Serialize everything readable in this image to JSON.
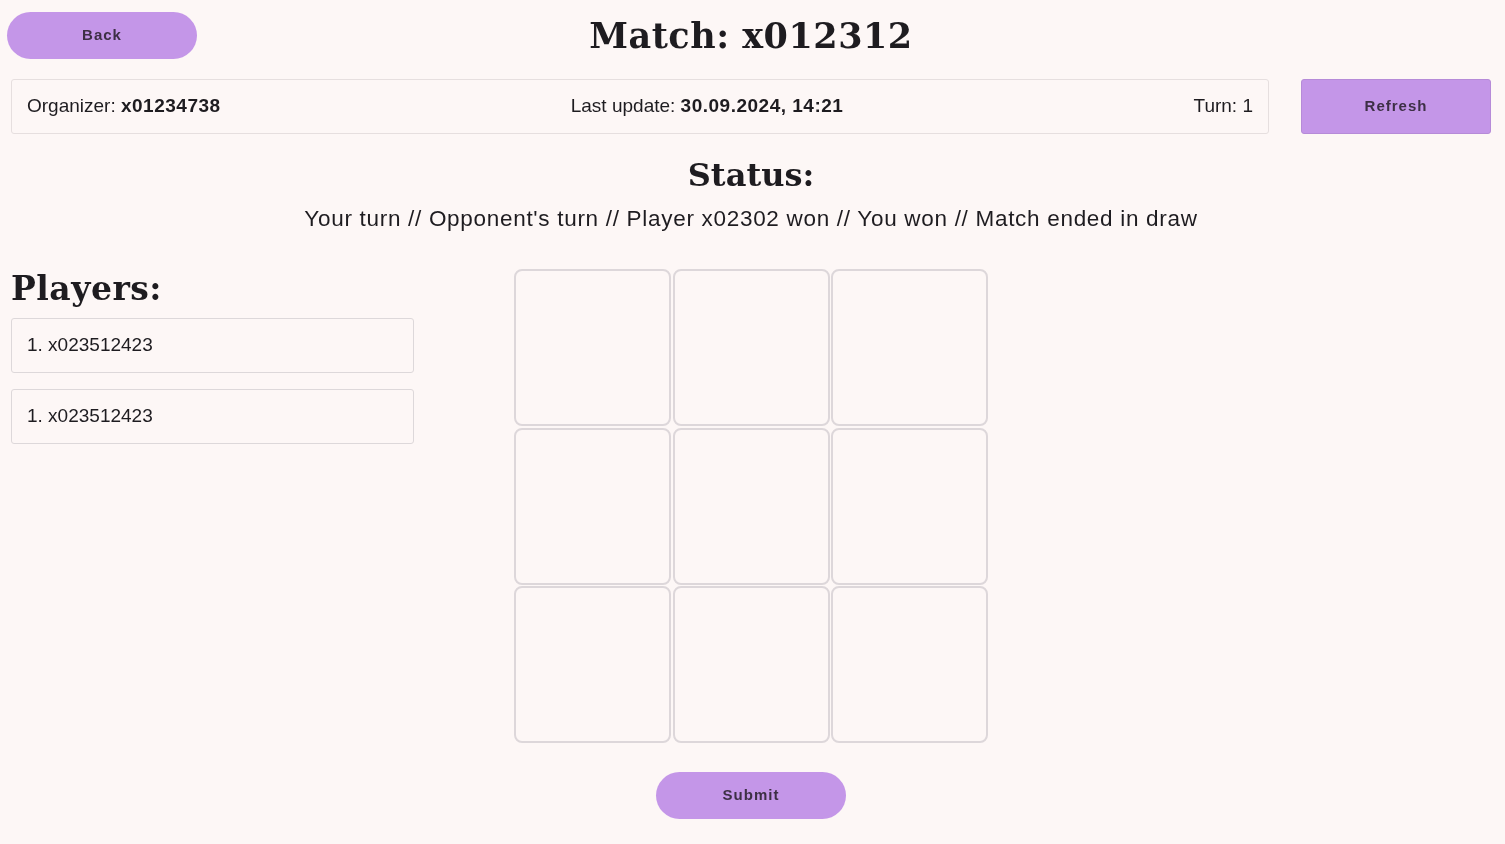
{
  "header": {
    "back_button": "Back",
    "title": "Match: x012312"
  },
  "info_bar": {
    "organizer": "Organizer: **x01234738**",
    "last_update": "Last update: **30.09.2024, 14:21**",
    "turn": "Turn: 1"
  },
  "refresh_button": "Refresh",
  "status": {
    "heading": "Status:",
    "text": "Your turn // Opponent's turn // Player x02302 won // You won // Match ended in draw"
  },
  "players": {
    "heading": "Players:",
    "items": [
      "1. x023512423",
      "1. x023512423"
    ]
  },
  "board": {
    "cells": [
      {
        "kind": "empty"
      },
      {
        "kind": "empty"
      },
      {
        "kind": "empty"
      },
      {
        "kind": "empty"
      },
      {
        "kind": "empty"
      },
      {
        "kind": "empty"
      },
      {
        "kind": "empty"
      },
      {
        "kind": "empty"
      },
      {
        "kind": "empty"
      }
    ]
  },
  "submit_button": "Submit"
}
